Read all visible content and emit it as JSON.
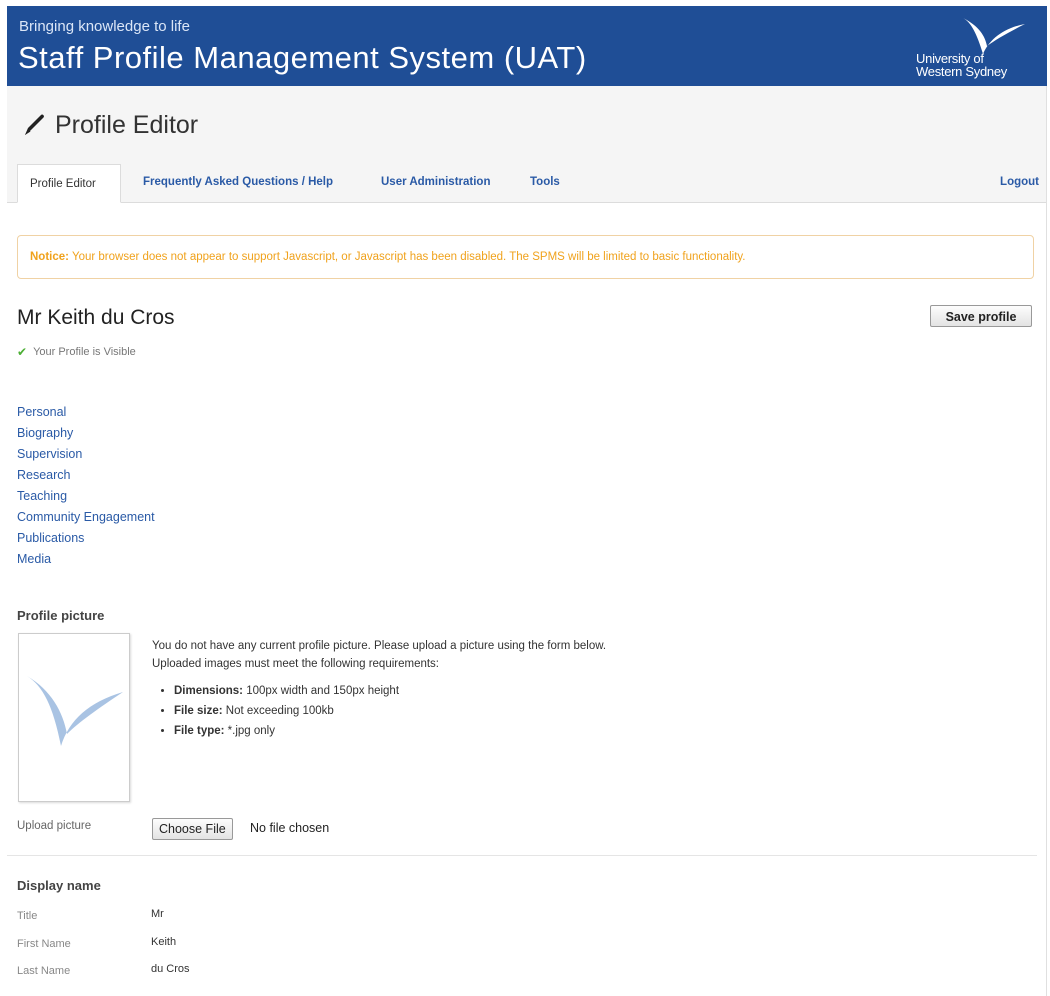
{
  "banner": {
    "tagline": "Bringing knowledge to life",
    "title": "Staff Profile Management System (UAT)",
    "logo_line1": "University of",
    "logo_line2": "Western Sydney"
  },
  "page": {
    "heading": "Profile Editor",
    "icon": "pencil-icon"
  },
  "tabs": [
    {
      "label": "Profile Editor",
      "active": true
    },
    {
      "label": "Frequently Asked Questions / Help",
      "active": false
    },
    {
      "label": "User Administration",
      "active": false
    },
    {
      "label": "Tools",
      "active": false
    }
  ],
  "logout_label": "Logout",
  "notice": {
    "prefix": "Notice:",
    "text": " Your browser does not appear to support Javascript, or Javascript has been disabled. The SPMS will be limited to basic functionality."
  },
  "profile": {
    "name": "Mr Keith du Cros",
    "visible_status": "Your Profile is Visible",
    "save_label": "Save profile"
  },
  "section_nav": [
    "Personal",
    "Biography",
    "Supervision",
    "Research",
    "Teaching",
    "Community Engagement",
    "Publications",
    "Media"
  ],
  "picture": {
    "section_title": "Profile picture",
    "line1": "You do not have any current profile picture. Please upload a picture using the form below.",
    "line2": "Uploaded images must meet the following requirements:",
    "requirements": [
      {
        "label": "Dimensions:",
        "value": " 100px width and 150px height"
      },
      {
        "label": "File size:",
        "value": " Not exceeding 100kb"
      },
      {
        "label": "File type:",
        "value": " *.jpg only"
      }
    ],
    "upload_label": "Upload picture",
    "choose_label": "Choose File",
    "no_file": "No file chosen"
  },
  "display_name": {
    "section_title": "Display name",
    "fields": [
      {
        "label": "Title",
        "value": "Mr"
      },
      {
        "label": "First Name",
        "value": "Keith"
      },
      {
        "label": "Last Name",
        "value": "du Cros"
      }
    ]
  },
  "colors": {
    "banner": "#1f4e96",
    "link": "#2a5aa6",
    "notice": "#f0a21c",
    "check": "#4caf35"
  }
}
